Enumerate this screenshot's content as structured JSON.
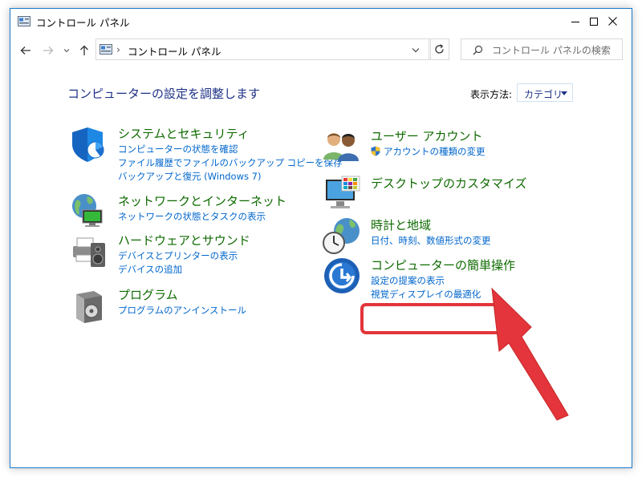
{
  "window": {
    "title": "コントロール パネル"
  },
  "address": {
    "crumb": "コントロール パネル",
    "sep1": "›",
    "sep2": "›"
  },
  "search": {
    "placeholder": "コントロール パネルの検索"
  },
  "header": {
    "title": "コンピューターの設定を調整します",
    "view_label": "表示方法:",
    "view_value": "カテゴリ"
  },
  "categories": [
    {
      "title": "システムとセキュリティ",
      "links": [
        "コンピューターの状態を確認",
        "ファイル履歴でファイルのバックアップ コピーを保存",
        "バックアップと復元 (Windows 7)"
      ]
    },
    {
      "title": "ネットワークとインターネット",
      "links": [
        "ネットワークの状態とタスクの表示"
      ]
    },
    {
      "title": "ハードウェアとサウンド",
      "links": [
        "デバイスとプリンターの表示",
        "デバイスの追加"
      ]
    },
    {
      "title": "プログラム",
      "links": [
        "プログラムのアンインストール"
      ]
    },
    {
      "title": "ユーザー アカウント",
      "links": [
        "アカウントの種類の変更"
      ]
    },
    {
      "title": "デスクトップのカスタマイズ",
      "links": []
    },
    {
      "title": "時計と地域",
      "links": [
        "日付、時刻、数値形式の変更"
      ]
    },
    {
      "title": "コンピューターの簡単操作",
      "links": [
        "設定の提案の表示",
        "視覚ディスプレイの最適化"
      ]
    }
  ],
  "colors": {
    "accent": "#1979ca",
    "title_blue": "#1e3287",
    "category_green": "#0e6a00",
    "link_blue": "#0066cc",
    "highlight_red": "#e3353b"
  }
}
